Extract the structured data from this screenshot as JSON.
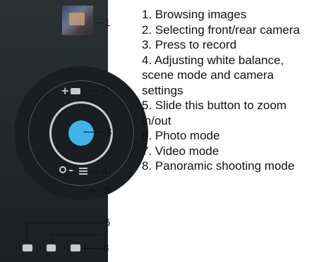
{
  "callout_numbers": [
    "1",
    "2",
    "3",
    "4",
    "5",
    "6",
    "7",
    "8"
  ],
  "legend": [
    "1. Browsing images",
    "2. Selecting front/rear camera",
    "3. Press to record",
    "4. Adjusting white balance, scene mode and camera settings",
    "5. Slide this button to zoom in/out",
    "6. Photo mode",
    "7. Video mode",
    "8. Panoramic shooting mode"
  ],
  "colors": {
    "panel": "#24292b",
    "record_button": "#3fb4ea",
    "icon": "#c7cbce"
  },
  "icons": {
    "browse": "image-thumbnail-icon",
    "switch_camera": "switch-camera-icon",
    "record": "record-button",
    "settings": "settings-icon",
    "zoom": "zoom-icon",
    "photo": "photo-mode-icon",
    "video": "video-mode-icon",
    "panorama": "panorama-mode-icon"
  }
}
